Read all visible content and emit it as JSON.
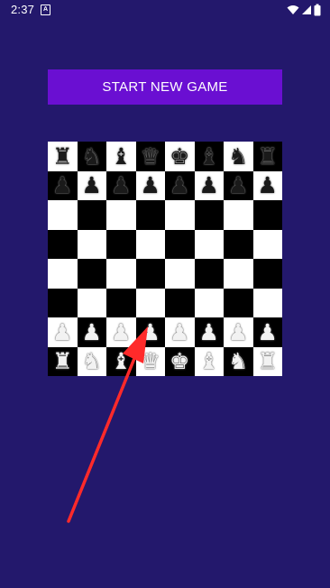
{
  "status_bar": {
    "time": "2:37",
    "notification_icon": "A"
  },
  "start_button": {
    "label": "START NEW GAME",
    "color": "#6a0fd2"
  },
  "board": {
    "light_color": "#ffffff",
    "dark_color": "#000000",
    "rows": [
      [
        "black-rook",
        "black-knight",
        "black-bishop",
        "black-queen",
        "black-king",
        "black-bishop",
        "black-knight",
        "black-rook"
      ],
      [
        "black-pawn",
        "black-pawn",
        "black-pawn",
        "black-pawn",
        "black-pawn",
        "black-pawn",
        "black-pawn",
        "black-pawn"
      ],
      [
        "",
        "",
        "",
        "",
        "",
        "",
        "",
        ""
      ],
      [
        "",
        "",
        "",
        "",
        "",
        "",
        "",
        ""
      ],
      [
        "",
        "",
        "",
        "",
        "",
        "",
        "",
        ""
      ],
      [
        "",
        "",
        "",
        "",
        "",
        "",
        "",
        ""
      ],
      [
        "white-pawn",
        "white-pawn",
        "white-pawn",
        "white-pawn",
        "white-pawn",
        "white-pawn",
        "white-pawn",
        "white-pawn"
      ],
      [
        "white-rook",
        "white-knight",
        "white-bishop",
        "white-queen",
        "white-king",
        "white-bishop",
        "white-knight",
        "white-rook"
      ]
    ]
  },
  "annotation": {
    "type": "arrow",
    "color": "#ff2a2a",
    "points_to": "d2 white pawn"
  }
}
